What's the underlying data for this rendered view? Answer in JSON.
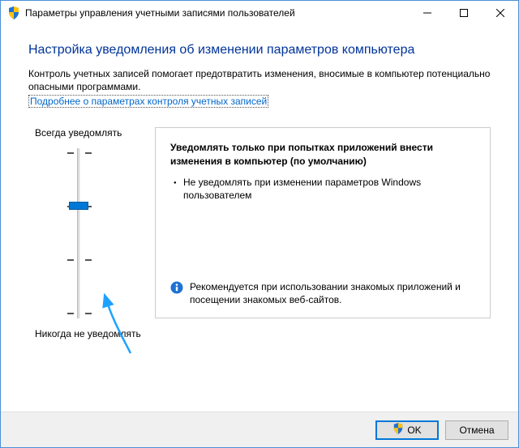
{
  "window": {
    "title": "Параметры управления учетными записями пользователей"
  },
  "heading": "Настройка уведомления об изменении параметров компьютера",
  "intro": "Контроль учетных записей помогает предотвратить изменения, вносимые в компьютер потенциально опасными программами.",
  "help_link": "Подробнее о параметрах контроля учетных записей",
  "slider": {
    "top_label": "Всегда уведомлять",
    "bottom_label": "Никогда не уведомлять",
    "levels": 4,
    "selected_index": 1
  },
  "setting": {
    "title": "Уведомлять только при попытках приложений внести изменения в компьютер (по умолчанию)",
    "bullet1": "Не уведомлять при изменении параметров Windows пользователем",
    "recommendation": "Рекомендуется при использовании знакомых приложений и посещении знакомых веб-сайтов."
  },
  "buttons": {
    "ok": "OK",
    "cancel": "Отмена"
  }
}
